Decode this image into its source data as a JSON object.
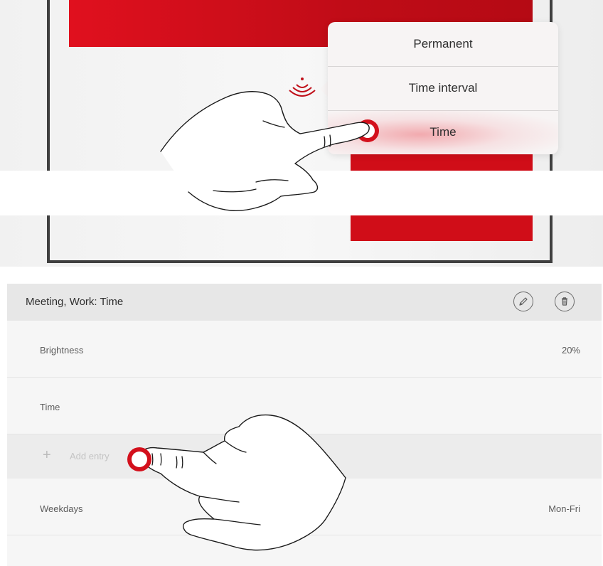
{
  "popover": {
    "items": [
      "Permanent",
      "Time interval",
      "Time"
    ],
    "selected": "Time"
  },
  "group": {
    "title": "Meeting, Work: Time",
    "edit_icon": "pencil-icon",
    "delete_icon": "trash-icon"
  },
  "rows": {
    "brightness": {
      "label": "Brightness",
      "value": "20%"
    },
    "time": {
      "label": "Time"
    },
    "add_entry": {
      "icon": "plus-icon",
      "label": "Add entry"
    },
    "weekdays": {
      "label": "Weekdays",
      "value": "Mon-Fri"
    }
  },
  "colors": {
    "accent_red": "#d00d18",
    "frame": "#3f3f3f",
    "header_bg": "#e7e7e7",
    "row_bg": "#f6f6f6"
  }
}
